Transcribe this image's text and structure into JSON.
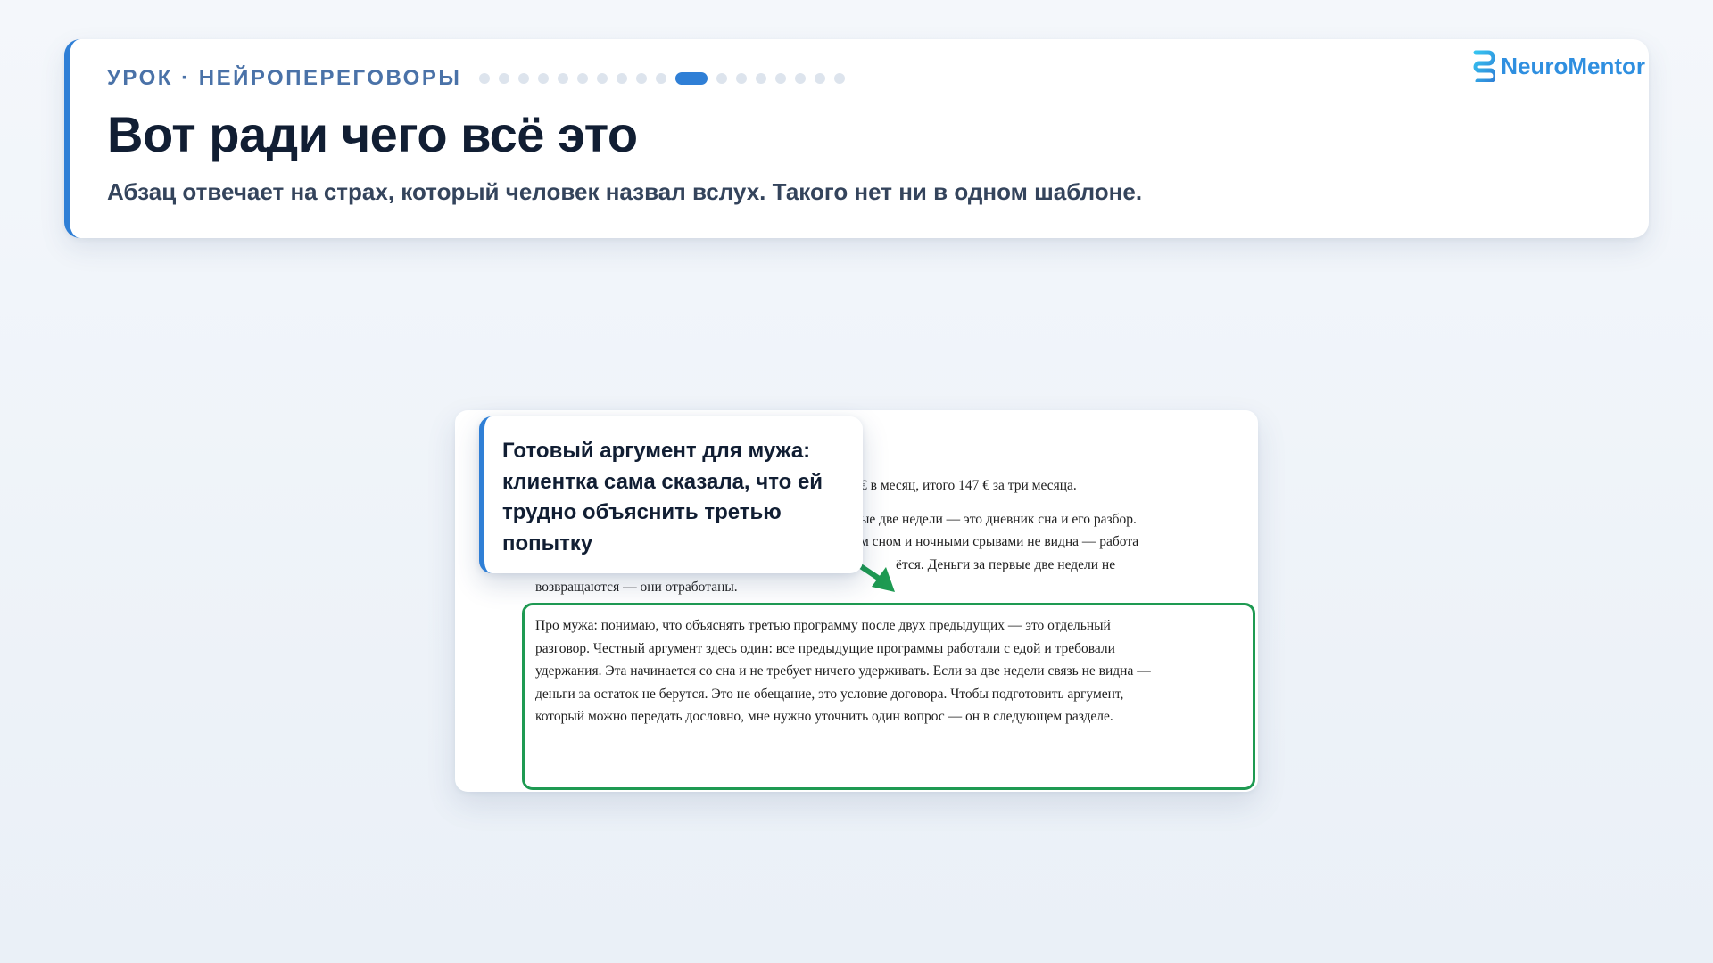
{
  "header": {
    "lesson_label": "УРОК · НЕЙРОПЕРЕГОВОРЫ",
    "progress": {
      "total_steps": 18,
      "current_step": 11
    },
    "title": "Вот ради чего всё это",
    "subtitle": "Абзац отвечает на страх, который человек назвал вслух. Такого нет ни в одном шаблоне."
  },
  "logo": {
    "text": "NeuroMentor",
    "icon": "neuromentor-logo-icon",
    "color": "#2f8fe0"
  },
  "document": {
    "visible_lines": [
      "€ в месяц, итого 147 € за три месяца.",
      "ые две недели — это дневник сна и его разбор.",
      "м сном и ночными срывами не видна — работа",
      "ётся. Деньги за первые две недели не",
      "возвращаются — они отработаны."
    ],
    "highlighted_paragraph": "Про мужа: понимаю, что объяснять третью программу после двух предыдущих — это отдельный разговор. Честный аргумент здесь один: все предыдущие программы работали с едой и требовали удержания. Эта начинается со сна и не требует ничего удерживать. Если за две недели связь не видна — деньги за остаток не берутся. Это не обещание, это условие договора. Чтобы подготовить аргумент, который можно передать дословно, мне нужно уточнить один вопрос — он в следующем разделе.",
    "highlight_color": "#1e9a52"
  },
  "callout": {
    "text": "Готовый аргумент для мужа: клиентка сама сказала, что ей трудно объяснить третью попытку",
    "accent_color": "#2f7fd6"
  },
  "arrow": {
    "icon": "arrow-down-right-icon",
    "color": "#1e9a52"
  }
}
